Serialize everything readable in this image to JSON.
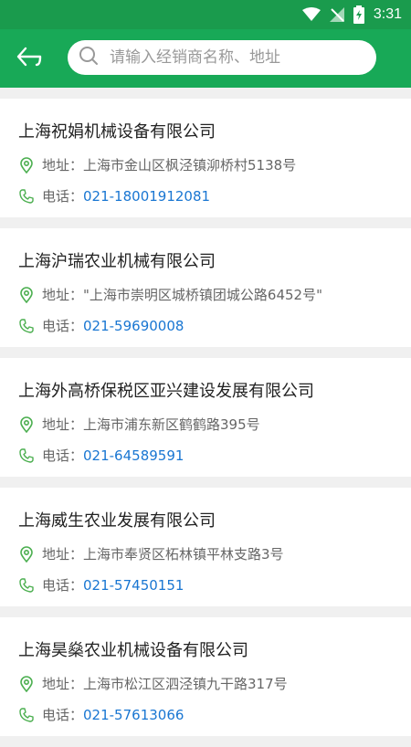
{
  "status_bar": {
    "time": "3:31"
  },
  "search": {
    "placeholder": "请输入经销商名称、地址"
  },
  "dealers": [
    {
      "name": "上海祝娟机械设备有限公司",
      "address_label": "地址：",
      "address": "上海市金山区枫泾镇泖桥村5138号",
      "phone_label": "电话：",
      "phone": "021-18001912081"
    },
    {
      "name": "上海沪瑞农业机械有限公司",
      "address_label": "地址：",
      "address": "\"上海市崇明区城桥镇团城公路6452号\"",
      "phone_label": "电话：",
      "phone": "021-59690008"
    },
    {
      "name": "上海外高桥保税区亚兴建设发展有限公司",
      "address_label": "地址：",
      "address": "上海市浦东新区鹤鹤路395号",
      "phone_label": "电话：",
      "phone": "021-64589591"
    },
    {
      "name": "上海威生农业发展有限公司",
      "address_label": "地址：",
      "address": "上海市奉贤区柘林镇平林支路3号",
      "phone_label": "电话：",
      "phone": "021-57450151"
    },
    {
      "name": "上海昊燊农业机械设备有限公司",
      "address_label": "地址：",
      "address": "上海市松江区泗泾镇九干路317号",
      "phone_label": "电话：",
      "phone": "021-57613066"
    }
  ],
  "colors": {
    "primary": "#18a957",
    "status_bar": "#1a9b4d",
    "phone_link": "#1976d2",
    "icon_green": "#4caf50"
  }
}
